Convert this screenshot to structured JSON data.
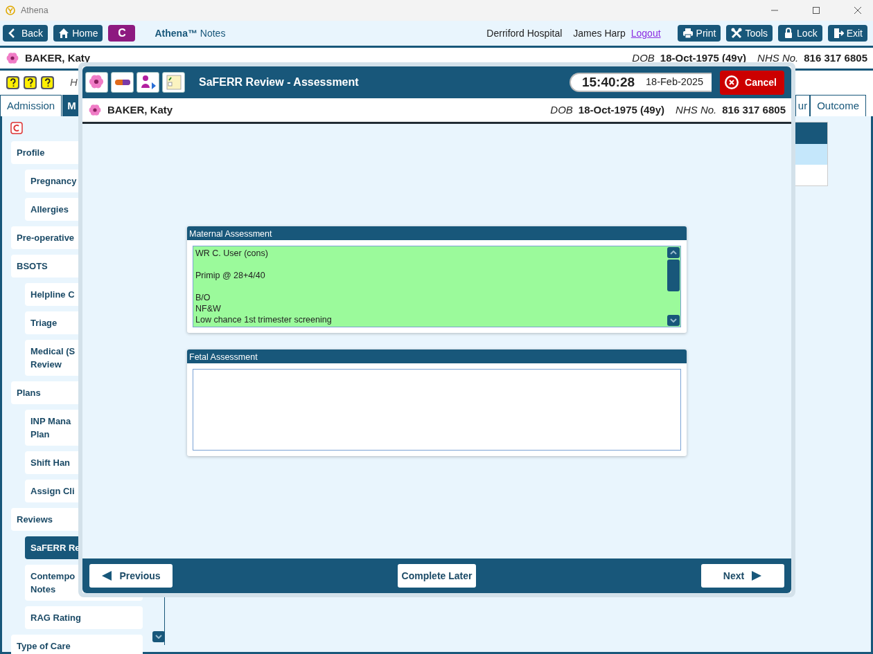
{
  "window": {
    "title": "Athena"
  },
  "toolbar": {
    "left_buttons": [
      {
        "label": "Back"
      },
      {
        "label": "Home"
      }
    ],
    "c_button": "C",
    "app_name": "**Athena™** Notes",
    "hospital": "Derriford Hospital",
    "user": "James Harp",
    "logout": "Logout",
    "right_buttons": [
      {
        "label": "Print"
      },
      {
        "label": "Tools"
      },
      {
        "label": "Lock"
      },
      {
        "label": "Exit"
      }
    ]
  },
  "patient": {
    "name": "BAKER, Katy",
    "dob_label": "DOB",
    "dob": "18-Oct-1975 (49y)",
    "nhs_label": "NHS No.",
    "nhs": "816 317 6805"
  },
  "subheader": {
    "text": "H"
  },
  "tabs": [
    {
      "label": "Admission",
      "selected": false
    },
    {
      "label": "M",
      "selected": true
    },
    {
      "label": "ur",
      "selected": false
    },
    {
      "label": "Outcome",
      "selected": false
    }
  ],
  "sidebar": {
    "items": [
      {
        "label": "Profile",
        "selected": false,
        "children": [
          {
            "label": "Pregnancy",
            "selected": false
          },
          {
            "label": "Allergies",
            "selected": false
          }
        ]
      },
      {
        "label": "Pre-operative",
        "selected": false
      },
      {
        "label": "BSOTS",
        "selected": false,
        "children": [
          {
            "label": "Helpline C",
            "selected": false
          },
          {
            "label": "Triage",
            "selected": false
          },
          {
            "label": "Medical (S\nReview",
            "selected": false
          }
        ]
      },
      {
        "label": "Plans",
        "selected": false,
        "children": [
          {
            "label": "INP Mana\nPlan",
            "selected": false
          },
          {
            "label": "Shift Han",
            "selected": false
          },
          {
            "label": "Assign Cli",
            "selected": false
          }
        ]
      },
      {
        "label": "Reviews",
        "selected": false,
        "children": [
          {
            "label": "SaFERR Re",
            "selected": true
          },
          {
            "label": "Contempo\nNotes",
            "selected": false
          },
          {
            "label": "RAG Rating",
            "selected": false
          }
        ]
      },
      {
        "label": "Type of Care",
        "selected": false
      }
    ]
  },
  "table": {
    "rows": [
      {
        "selected": true
      },
      {
        "selected": false
      }
    ]
  },
  "dialog": {
    "title": "SaFERR Review - Assessment",
    "time": "15:40:28",
    "date": "18-Feb-2025",
    "cancel": "Cancel",
    "patient": {
      "name": "BAKER, Katy",
      "dob_label": "DOB",
      "dob": "18-Oct-1975 (49y)",
      "nhs_label": "NHS No.",
      "nhs": "816 317 6805"
    },
    "panels": [
      {
        "title": "Maternal Assessment",
        "value": "WR C. User (cons)\n\nPrimip @ 28+4/40\n\nB/O\nNF&W\nLow chance 1st trimester screening",
        "highlighted": true
      },
      {
        "title": "Fetal Assessment",
        "highlighted": false
      }
    ],
    "previous": "Previous",
    "complete_later": "Complete Later",
    "next": "Next"
  }
}
